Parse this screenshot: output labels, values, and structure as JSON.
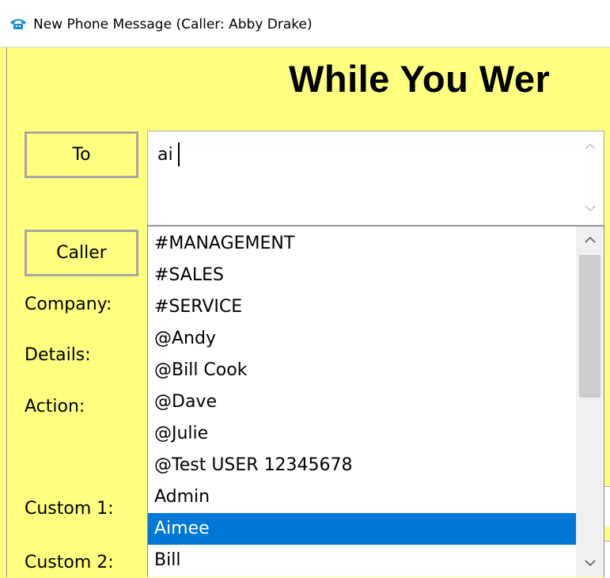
{
  "window": {
    "title": "New Phone Message (Caller: Abby Drake)",
    "icon": "phone-icon"
  },
  "headline": "While You Wer",
  "buttons": {
    "to_label": "To",
    "caller_label": "Caller"
  },
  "labels": {
    "company": "Company:",
    "details": "Details:",
    "action": "Action:",
    "custom1": "Custom 1:",
    "custom2": "Custom 2:"
  },
  "to_field": {
    "value": "ai"
  },
  "dropdown": {
    "items": [
      "#MANAGEMENT",
      "#SALES",
      "#SERVICE",
      "@Andy",
      "@Bill Cook",
      "@Dave",
      "@Julie",
      "@Test USER 12345678",
      "Admin",
      "Aimee",
      "Bill"
    ],
    "selected": "Aimee"
  },
  "colors": {
    "background": "#ffff80",
    "selection": "#0078d7",
    "title_icon": "#1a8fd6"
  }
}
